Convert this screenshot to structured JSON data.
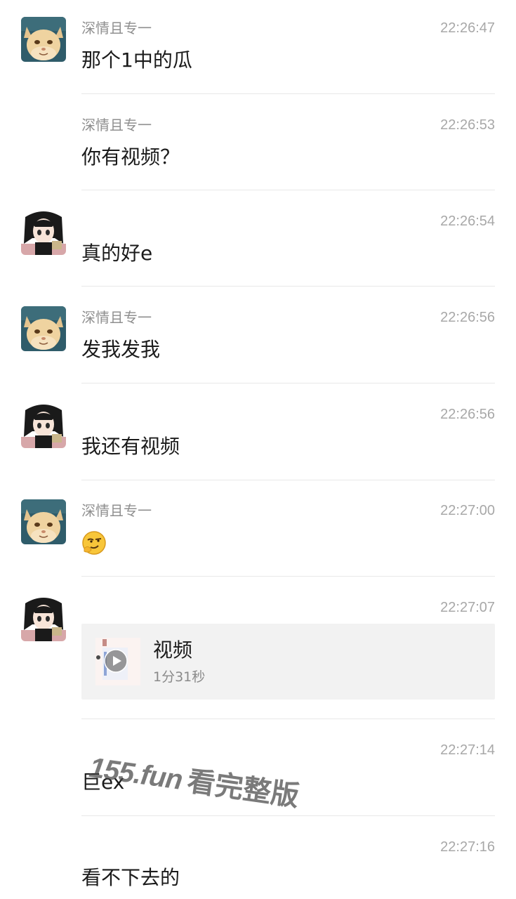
{
  "colors": {
    "background": "#ffffff",
    "divider": "#e8e8e8",
    "sender_text": "#8f8f8f",
    "time_text": "#a8a8a8",
    "video_card_bg": "#f2f2f2"
  },
  "messages": [
    {
      "sender": "深情且专一",
      "time": "22:26:47",
      "text": "那个1中的瓜",
      "avatar": "cat-avatar"
    },
    {
      "sender": "深情且专一",
      "time": "22:26:53",
      "text": "你有视频？",
      "avatar": ""
    },
    {
      "sender": "",
      "time": "22:26:54",
      "text": "真的好e",
      "avatar": "anime-girl-avatar"
    },
    {
      "sender": "深情且专一",
      "time": "22:26:56",
      "text": "发我发我",
      "avatar": "cat-avatar"
    },
    {
      "sender": "",
      "time": "22:26:56",
      "text": "我还有视频",
      "avatar": "anime-girl-avatar"
    },
    {
      "sender": "深情且专一",
      "time": "22:27:00",
      "emoji": "smirk-emoji",
      "avatar": "cat-avatar"
    },
    {
      "sender": "",
      "time": "22:27:07",
      "video": {
        "title": "视频",
        "duration": "1分31秒",
        "icon": "play-icon"
      },
      "avatar": "anime-girl-avatar"
    },
    {
      "sender": "",
      "time": "22:27:14",
      "text": "巨ex",
      "avatar": ""
    },
    {
      "sender": "",
      "time": "22:27:16",
      "text": "看不下去的",
      "avatar": ""
    }
  ],
  "watermark": {
    "url": "155.fun",
    "text": "看完整版"
  }
}
